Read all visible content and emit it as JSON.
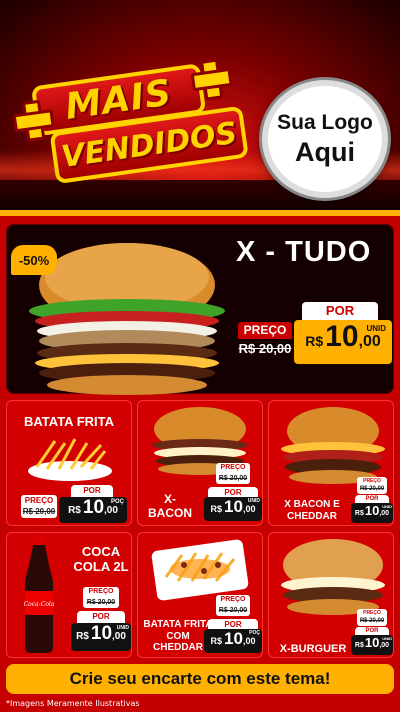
{
  "header": {
    "title_line1": "MAIS",
    "title_line2": "VENDIDOS",
    "logo_line1": "Sua Logo",
    "logo_line2": "Aqui"
  },
  "featured": {
    "discount": "-50%",
    "name": "X - TUDO",
    "preco_label": "PREÇO",
    "old_price": "R$ 20,00",
    "por_label": "POR",
    "currency": "R$",
    "price_int": "10",
    "price_dec": ",00",
    "unit": "UNID"
  },
  "cards": [
    {
      "name": "BATATA FRITA",
      "preco_label": "PREÇO",
      "old_price": "R$ 20,00",
      "por_label": "POR",
      "currency": "R$",
      "price_int": "10",
      "price_dec": ",00",
      "unit": "POÇ"
    },
    {
      "name": "X-BACON",
      "preco_label": "PREÇO",
      "old_price": "R$ 20,00",
      "por_label": "POR",
      "currency": "R$",
      "price_int": "10",
      "price_dec": ",00",
      "unit": "UNID"
    },
    {
      "name": "X BACON E CHEDDAR",
      "preco_label": "PREÇO",
      "old_price": "R$ 20,00",
      "por_label": "POR",
      "currency": "R$",
      "price_int": "10",
      "price_dec": ",00",
      "unit": "UNID"
    },
    {
      "name": "COCA COLA 2L",
      "preco_label": "PREÇO",
      "old_price": "R$ 20,00",
      "por_label": "POR",
      "currency": "R$",
      "price_int": "10",
      "price_dec": ",00",
      "unit": "UNID"
    },
    {
      "name": "BATATA FRITA COM CHEDDAR",
      "preco_label": "PREÇO",
      "old_price": "R$ 20,00",
      "por_label": "POR",
      "currency": "R$",
      "price_int": "10",
      "price_dec": ",00",
      "unit": "POÇ"
    },
    {
      "name": "X-BURGUER",
      "preco_label": "PREÇO",
      "old_price": "R$ 20,00",
      "por_label": "POR",
      "currency": "R$",
      "price_int": "10",
      "price_dec": ",00",
      "unit": "UNID"
    }
  ],
  "cta": "Crie seu encarte com este tema!",
  "disclaimer": "*Imagens Meramente Ilustrativas",
  "colors": {
    "red": "#c40000",
    "gold": "#ffb000",
    "dark": "#140000"
  },
  "images": {
    "coca_logo_text": "Coca-Cola"
  }
}
